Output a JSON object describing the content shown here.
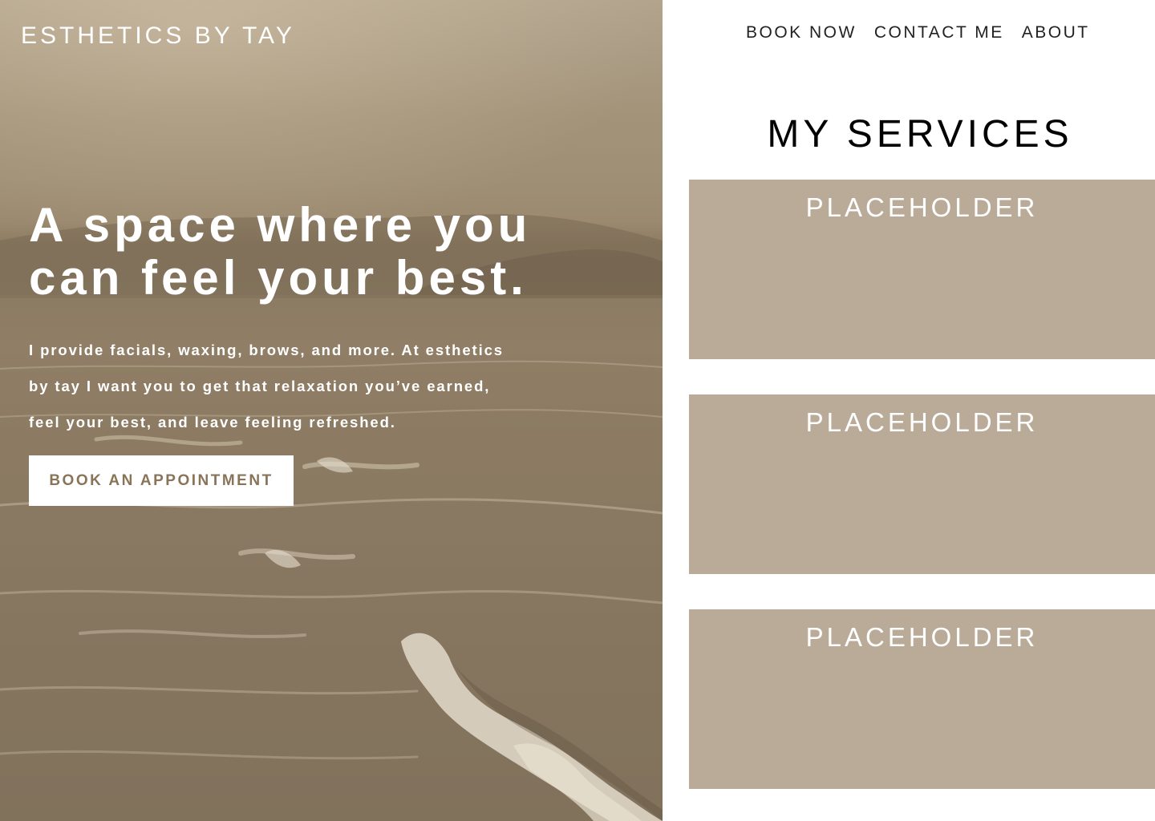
{
  "brand": {
    "name": "ESTHETICS BY TAY"
  },
  "hero": {
    "headline_line1": "A space where you",
    "headline_line2": "can feel your best.",
    "intro_line1": "I provide facials, waxing, brows, and more. At esthetics",
    "intro_line2": "by tay I want you to get that relaxation you’ve earned,",
    "intro_line3": "feel your best, and leave feeling refreshed.",
    "cta_label": "BOOK AN APPOINTMENT"
  },
  "nav": {
    "items": [
      {
        "label": "BOOK NOW"
      },
      {
        "label": "CONTACT ME"
      },
      {
        "label": "ABOUT"
      }
    ]
  },
  "services": {
    "title": "MY SERVICES",
    "cards": [
      {
        "title": "PLACEHOLDER"
      },
      {
        "title": "PLACEHOLDER"
      },
      {
        "title": "PLACEHOLDER"
      }
    ]
  },
  "colors": {
    "card_bg": "#baab99",
    "cta_text": "#8a7458",
    "panel_bg": "#ffffff"
  }
}
